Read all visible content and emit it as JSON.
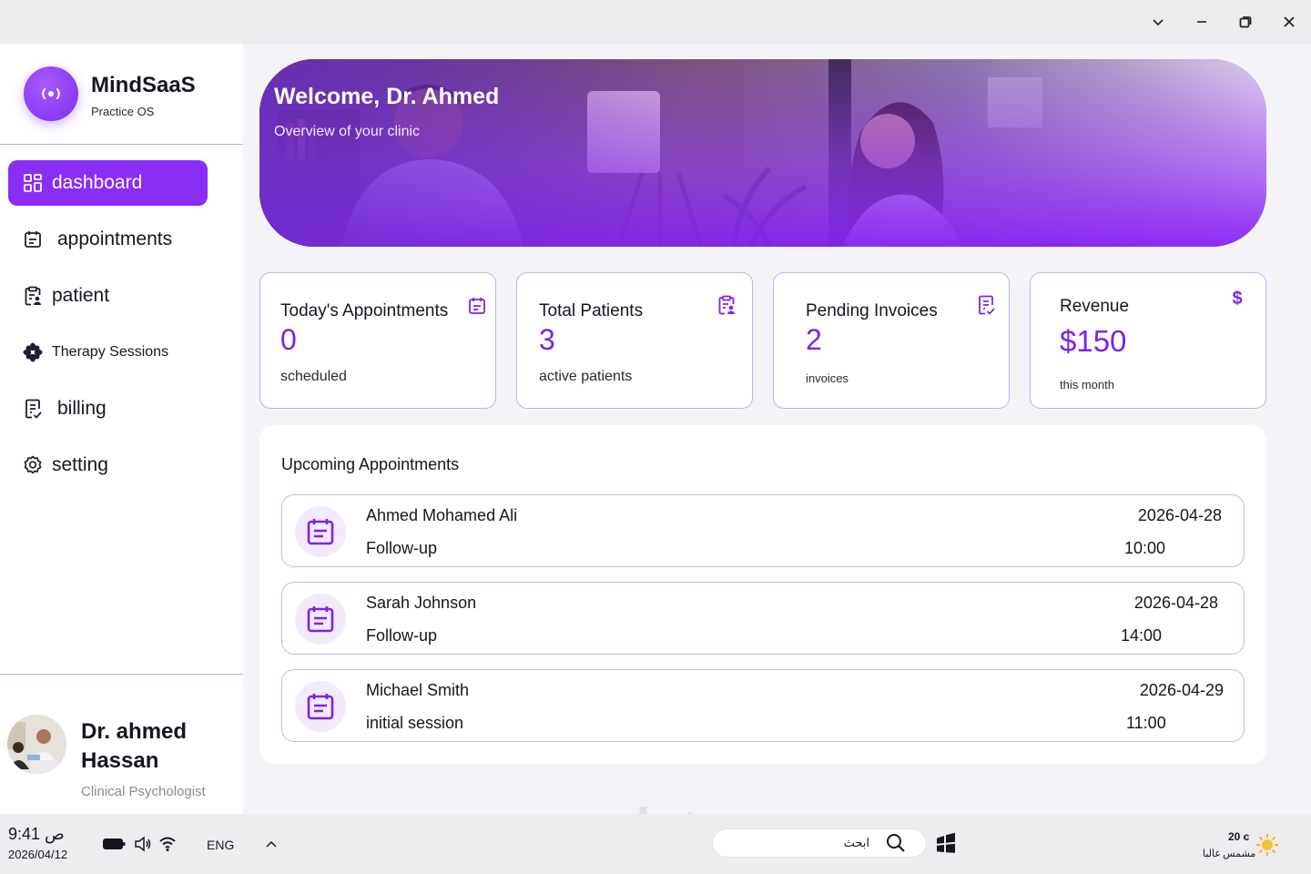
{
  "window": {
    "controls": [
      "chevron-down",
      "minimize",
      "restore",
      "close"
    ]
  },
  "sidebar": {
    "brand_name": "MindSaaS",
    "brand_sub": "Practice OS",
    "items": [
      {
        "label": "dashboard",
        "icon": "grid-icon",
        "active": true
      },
      {
        "label": "appointments",
        "icon": "calendar-icon",
        "active": false
      },
      {
        "label": "patient",
        "icon": "clipboard-user-icon",
        "active": false
      },
      {
        "label": "Therapy Sessions",
        "icon": "flower-icon",
        "active": false
      },
      {
        "label": "billing",
        "icon": "receipt-icon",
        "active": false
      },
      {
        "label": "setting",
        "icon": "gear-icon",
        "active": false
      }
    ],
    "doctor": {
      "name": "Dr. ahmed Hassan",
      "role": "Clinical Psychologist"
    }
  },
  "hero": {
    "title": "Welcome, Dr. Ahmed",
    "subtitle": "Overview of your clinic"
  },
  "stats": [
    {
      "title": "Today's Appointments",
      "value": "0",
      "sub": "scheduled",
      "icon": "calendar-icon"
    },
    {
      "title": "Total Patients",
      "value": "3",
      "sub": "active patients",
      "icon": "clipboard-user-icon"
    },
    {
      "title": "Pending Invoices",
      "value": "2",
      "sub": "invoices",
      "icon": "invoice-check-icon"
    },
    {
      "title": "Revenue",
      "value": "$150",
      "sub": "this month",
      "icon": "dollar-icon"
    }
  ],
  "upcoming": {
    "title": "Upcoming Appointments",
    "rows": [
      {
        "name": "Ahmed Mohamed Ali",
        "type": "Follow-up",
        "date": "2026-04-28",
        "time": "10:00"
      },
      {
        "name": "Sarah Johnson",
        "type": "Follow-up",
        "date": "2026-04-28",
        "time": "14:00"
      },
      {
        "name": "Michael Smith",
        "type": "initial session",
        "date": "2026-04-29",
        "time": "11:00"
      }
    ]
  },
  "taskbar": {
    "time": "9:41 ص",
    "date": "2026/04/12",
    "language": "ENG",
    "search_placeholder": "ابحث",
    "weather_temp": "20 c",
    "weather_desc": "مشمس غالبا"
  },
  "colors": {
    "accent": "#8a2df5",
    "accent_text": "#7c22ec",
    "card_border": "#c8aef0"
  }
}
